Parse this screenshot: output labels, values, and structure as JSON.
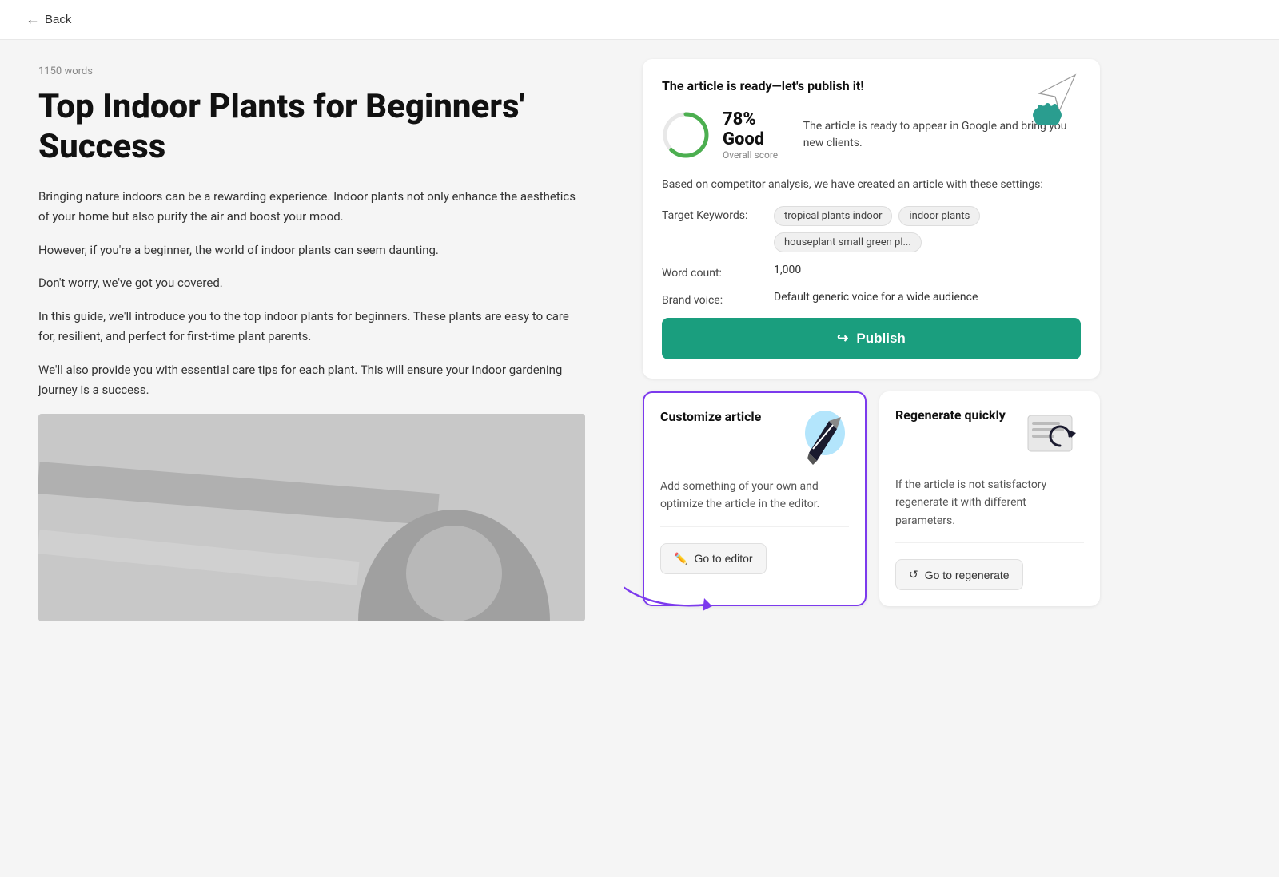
{
  "header": {
    "back_label": "Back"
  },
  "article": {
    "word_count": "1150 words",
    "title": "Top Indoor Plants for Beginners' Success",
    "paragraphs": [
      "Bringing nature indoors can be a rewarding experience. Indoor plants not only enhance the aesthetics of your home but also purify the air and boost your mood.",
      "However, if you're a beginner, the world of indoor plants can seem daunting.",
      "Don't worry, we've got you covered.",
      "In this guide, we'll introduce you to the top indoor plants for beginners. These plants are easy to care for, resilient, and perfect for first-time plant parents.",
      "We'll also provide you with essential care tips for each plant. This will ensure your indoor gardening journey is a success."
    ]
  },
  "score_card": {
    "heading": "The article is ready—let's publish it!",
    "score_percent": 78,
    "score_label": "78% Good",
    "score_sublabel": "Overall score",
    "score_description": "The article is ready to appear in Google and bring you new clients.",
    "settings_intro": "Based on competitor analysis, we have created an article with these settings:",
    "target_keywords_label": "Target Keywords:",
    "keywords": [
      "tropical plants indoor",
      "indoor plants",
      "houseplant small green pl..."
    ],
    "word_count_label": "Word count:",
    "word_count_value": "1,000",
    "brand_voice_label": "Brand voice:",
    "brand_voice_value": "Default generic voice for a wide audience",
    "publish_label": "Publish"
  },
  "customize_card": {
    "title": "Customize article",
    "body": "Add something of your own and optimize the article in the editor.",
    "button_label": "Go to editor"
  },
  "regenerate_card": {
    "title": "Regenerate quickly",
    "body": "If the article is not satisfactory regenerate it with different parameters.",
    "button_label": "Go to regenerate"
  }
}
